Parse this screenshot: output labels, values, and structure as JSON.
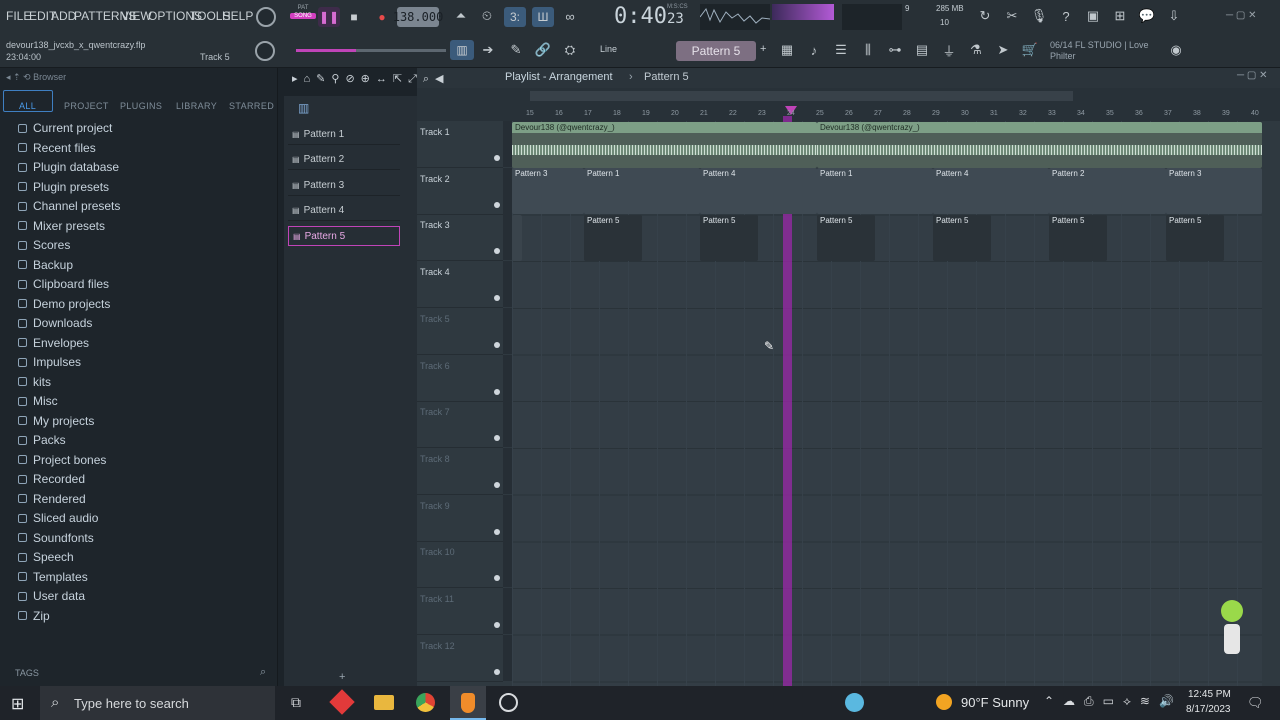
{
  "menu": [
    "FILE",
    "EDIT",
    "ADD",
    "PATTERNS",
    "VIEW",
    "OPTIONS",
    "TOOLS",
    "HELP"
  ],
  "transport": {
    "mode": "PAT",
    "mode2": "SONG",
    "tempo": "138.000",
    "time_main": "0:40",
    "time_sub": "23",
    "time_label": "M:S:CS"
  },
  "meters": {
    "cpu": "9",
    "ram": "285 MB",
    "poly": "10"
  },
  "project": {
    "file": "devour138_jvcxb_x_qwentcrazy.flp",
    "length": "23:04:00",
    "track": "Track 5"
  },
  "snap": "Line",
  "pattern_selector": "Pattern 5",
  "news": {
    "line1": "06/14  FL STUDIO | Love",
    "line2": "Philter"
  },
  "browser": {
    "title": "Browser",
    "tabs": [
      "ALL",
      "PROJECT",
      "PLUGINS",
      "LIBRARY",
      "STARRED"
    ],
    "items": [
      "Current project",
      "Recent files",
      "Plugin database",
      "Plugin presets",
      "Channel presets",
      "Mixer presets",
      "Scores",
      "Backup",
      "Clipboard files",
      "Demo projects",
      "Downloads",
      "Envelopes",
      "Impulses",
      "kits",
      "Misc",
      "My projects",
      "Packs",
      "Project bones",
      "Recorded",
      "Rendered",
      "Sliced audio",
      "Soundfonts",
      "Speech",
      "Templates",
      "User data",
      "Zip"
    ],
    "tags": "TAGS"
  },
  "patterns": [
    "Pattern 1",
    "Pattern 2",
    "Pattern 3",
    "Pattern 4",
    "Pattern 5"
  ],
  "playlist": {
    "title": "Playlist - Arrangement",
    "pattern": "Pattern 5",
    "ruler": [
      "15",
      "16",
      "17",
      "18",
      "19",
      "20",
      "21",
      "22",
      "23",
      "24",
      "25",
      "26",
      "27",
      "28",
      "29",
      "30",
      "31",
      "32",
      "33",
      "34",
      "35",
      "36",
      "37",
      "38",
      "39",
      "40"
    ],
    "tracks": [
      "Track 1",
      "Track 2",
      "Track 3",
      "Track 4",
      "Track 5",
      "Track 6",
      "Track 7",
      "Track 8",
      "Track 9",
      "Track 10",
      "Track 11",
      "Track 12"
    ],
    "audio_clip": "Devour138 (@qwentcrazy_)",
    "row2_clips": [
      "Pattern 3",
      "Pattern 1",
      "Pattern 4",
      "Pattern 1",
      "Pattern 4",
      "Pattern 2",
      "Pattern 3"
    ],
    "row3_clips": [
      "Pattern 5",
      "Pattern 5",
      "Pattern 5",
      "Pattern 5",
      "Pattern 5",
      "Pattern 5"
    ]
  },
  "taskbar": {
    "search": "Type here to search",
    "weather": "90°F  Sunny",
    "time": "12:45 PM",
    "date": "8/17/2023"
  },
  "colors": {
    "accent": "#c044b8",
    "playhead": "#9b28aa",
    "clip_green": "#7d9f86",
    "clip_grey": "#3f4a53"
  }
}
